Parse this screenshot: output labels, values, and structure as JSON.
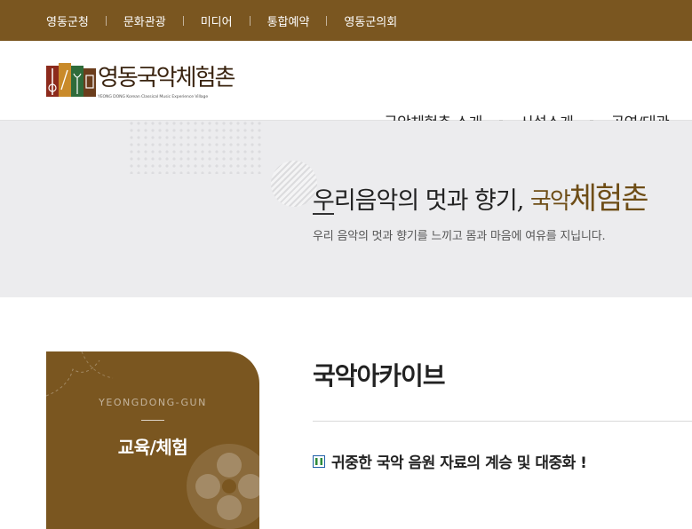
{
  "topbar": {
    "links": [
      "영동군청",
      "문화관광",
      "미디어",
      "통합예약",
      "영동군의회"
    ]
  },
  "logo": {
    "title": "영동국악체험촌",
    "subtitle": "YEONG DONG Korean Classical Music Experience Village"
  },
  "nav": {
    "items": [
      "국악체험촌 소개",
      "시설소개",
      "공연/대관"
    ]
  },
  "hero": {
    "title_prefix": "우리음악의 멋과 향기,",
    "title_accent_1": "국악",
    "title_accent_2": "체험촌",
    "subtitle": "우리 음악의 멋과 향기를 느끼고 몸과 마음에 여유를 지닙니다."
  },
  "sidebar": {
    "eng_label": "YEONGDONG-GUN",
    "title": "교육/체험"
  },
  "content": {
    "page_title": "국악아카이브",
    "subheading": "귀중한 국악 음원 자료의 계승 및 대중화 !"
  },
  "colors": {
    "brand_brown": "#7a5620",
    "accent_brown": "#6e4d16",
    "hero_bg": "#ececee",
    "icon_green": "#2e8b3a",
    "icon_blue": "#1f5fa8"
  },
  "icons": [
    "logo-emblem-icon",
    "square-bullet-icon",
    "flower-emblem-icon"
  ]
}
